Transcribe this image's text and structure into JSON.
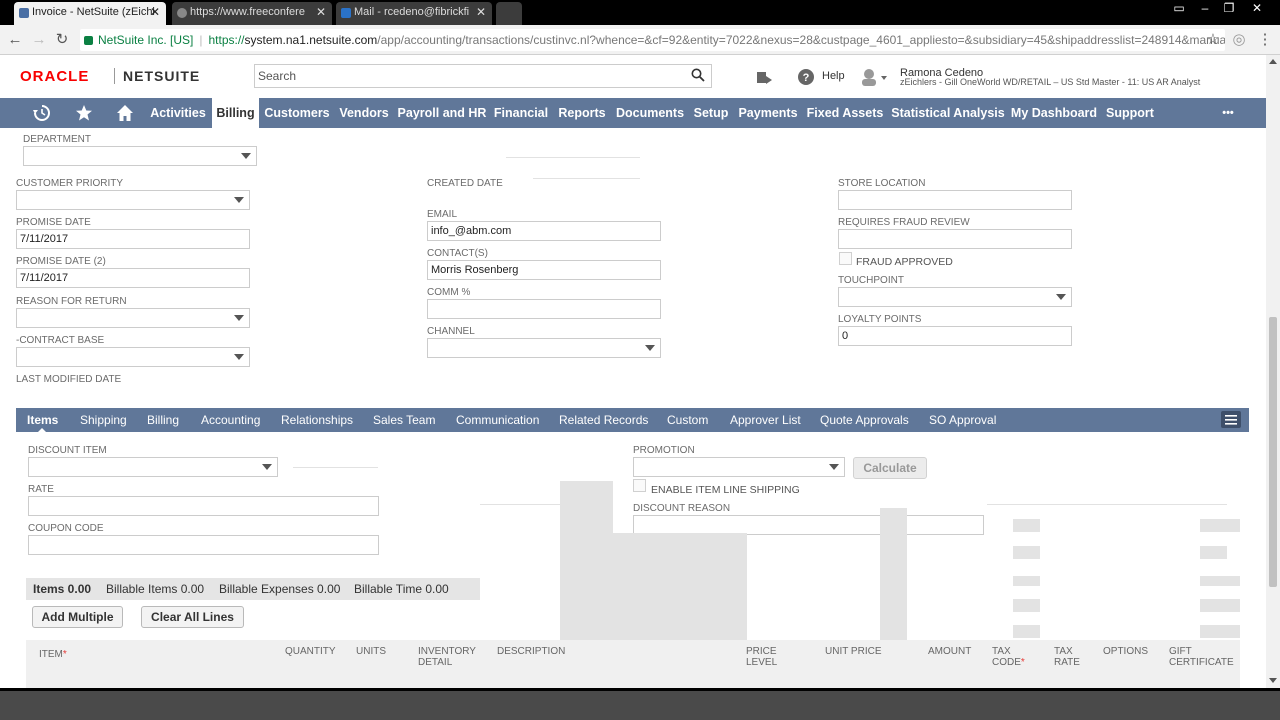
{
  "browser": {
    "tabs": [
      {
        "title": "Invoice - NetSuite (zEichl"
      },
      {
        "title": "https://www.freeconfere"
      },
      {
        "title": "Mail - rcedeno@fibrickfi"
      }
    ],
    "omnibox": {
      "secure_label": "NetSuite Inc. [US]",
      "protocol": "https://",
      "host": "system.na1.netsuite.com",
      "path": "/app/accounting/transactions/custinvc.nl?whence=&cf=92&entity=7022&nexus=28&custpage_4601_appliesto=&subsidiary=45&shipaddresslist=248914&manua"
    }
  },
  "header": {
    "brand_oracle": "ORACLE",
    "brand_netsuite": "NETSUITE",
    "search_placeholder": "Search",
    "help_label": "Help",
    "user_name": "Ramona Cedeno",
    "user_role": "zEichlers - Gill OneWorld WD/RETAIL – US Std Master - 11: US AR Analyst"
  },
  "nav": {
    "items": [
      "Activities",
      "Billing",
      "Customers",
      "Vendors",
      "Payroll and HR",
      "Financial",
      "Reports",
      "Documents",
      "Setup",
      "Payments",
      "Fixed Assets",
      "Statistical Analysis",
      "My Dashboard",
      "Support"
    ],
    "active": "Billing",
    "more": "•••"
  },
  "form": {
    "department_label": "DEPARTMENT",
    "customer_priority_label": "CUSTOMER PRIORITY",
    "promise_date_label": "PROMISE DATE",
    "promise_date_value": "7/11/2017",
    "promise_date2_label": "PROMISE DATE (2)",
    "promise_date2_value": "7/11/2017",
    "reason_for_return_label": "REASON FOR RETURN",
    "contract_base_label": "-CONTRACT BASE",
    "last_modified_label": "LAST MODIFIED DATE",
    "created_date_label": "CREATED DATE",
    "email_label": "EMAIL",
    "email_value": "info_@abm.com",
    "contacts_label": "CONTACT(S)",
    "contacts_value": "Morris Rosenberg",
    "comm_label": "COMM %",
    "channel_label": "CHANNEL",
    "store_location_label": "STORE LOCATION",
    "requires_fraud_label": "REQUIRES FRAUD REVIEW",
    "fraud_approved_label": "FRAUD APPROVED",
    "touchpoint_label": "TOUCHPOINT",
    "loyalty_label": "LOYALTY POINTS",
    "loyalty_value": "0"
  },
  "subtabs": {
    "items": [
      "Items",
      "Shipping",
      "Billing",
      "Accounting",
      "Relationships",
      "Sales Team",
      "Communication",
      "Related Records",
      "Custom",
      "Approver List",
      "Quote Approvals",
      "SO Approval"
    ],
    "active": "Items"
  },
  "items_tab": {
    "discount_item_label": "DISCOUNT ITEM",
    "rate_label": "RATE",
    "coupon_label": "COUPON CODE",
    "promotion_label": "PROMOTION",
    "calculate_label": "Calculate",
    "enable_shipping_label": "ENABLE ITEM LINE SHIPPING",
    "discount_reason_label": "DISCOUNT REASON",
    "totals": {
      "items": "Items 0.00",
      "billable_items": "Billable Items 0.00",
      "billable_expenses": "Billable Expenses 0.00",
      "billable_time": "Billable Time 0.00"
    },
    "add_multiple_label": "Add Multiple",
    "clear_all_label": "Clear All Lines",
    "columns": {
      "item": "ITEM",
      "quantity": "QUANTITY",
      "units": "UNITS",
      "inventory_detail_1": "INVENTORY",
      "inventory_detail_2": "DETAIL",
      "description": "DESCRIPTION",
      "price_level_1": "PRICE",
      "price_level_2": "LEVEL",
      "unit_price": "UNIT PRICE",
      "amount": "AMOUNT",
      "tax_code_1": "TAX",
      "tax_code_2": "CODE",
      "tax_rate_1": "TAX",
      "tax_rate_2": "RATE",
      "options": "OPTIONS",
      "gift_cert_1": "GIFT",
      "gift_cert_2": "CERTIFICATE"
    },
    "required_mark": "*"
  },
  "colors": {
    "nav_bg": "#607799",
    "oracle_red": "#f80000",
    "secure_green": "#0b8043"
  }
}
